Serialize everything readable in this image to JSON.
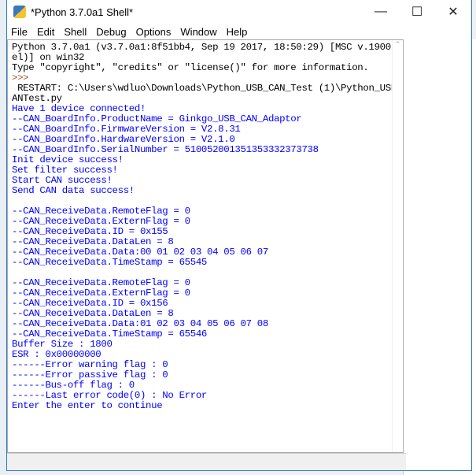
{
  "window": {
    "title": "*Python 3.7.0a1 Shell*"
  },
  "menu": [
    "File",
    "Edit",
    "Shell",
    "Debug",
    "Options",
    "Window",
    "Help"
  ],
  "lines": [
    {
      "t": "Python 3.7.0a1 (v3.7.0a1:8f51bb4, Sep 19 2017, 18:50:29) [MSC v.1900 32 bit (Int",
      "c": "k"
    },
    {
      "t": "el)] on win32",
      "c": "k"
    },
    {
      "t": "Type \"copyright\", \"credits\" or \"license()\" for more information.",
      "c": "k"
    },
    {
      "t": ">>>",
      "c": "p"
    },
    {
      "t": " RESTART: C:\\Users\\wdluo\\Downloads\\Python_USB_CAN_Test (1)\\Python_USB_CAN_Test\\C",
      "c": "k"
    },
    {
      "t": "ANTest.py",
      "c": "k"
    },
    {
      "t": "Have 1 device connected!",
      "c": "o"
    },
    {
      "t": "--CAN_BoardInfo.ProductName = Ginkgo_USB_CAN_Adaptor",
      "c": "o"
    },
    {
      "t": "--CAN_BoardInfo.FirmwareVersion = V2.8.31",
      "c": "o"
    },
    {
      "t": "--CAN_BoardInfo.HardwareVersion = V2.1.0",
      "c": "o"
    },
    {
      "t": "--CAN_BoardInfo.SerialNumber = 51005200135135333237373​8",
      "c": "o"
    },
    {
      "t": "Init device success!",
      "c": "o"
    },
    {
      "t": "Set filter success!",
      "c": "o"
    },
    {
      "t": "Start CAN success!",
      "c": "o"
    },
    {
      "t": "Send CAN data success!",
      "c": "o"
    },
    {
      "t": "",
      "c": "o"
    },
    {
      "t": "--CAN_ReceiveData.RemoteFlag = 0",
      "c": "o"
    },
    {
      "t": "--CAN_ReceiveData.ExternFlag = 0",
      "c": "o"
    },
    {
      "t": "--CAN_ReceiveData.ID = 0x155",
      "c": "o"
    },
    {
      "t": "--CAN_ReceiveData.DataLen = 8",
      "c": "o"
    },
    {
      "t": "--CAN_ReceiveData.Data:00 01 02 03 04 05 06 07",
      "c": "o"
    },
    {
      "t": "--CAN_ReceiveData.TimeStamp = 65545",
      "c": "o"
    },
    {
      "t": "",
      "c": "o"
    },
    {
      "t": "--CAN_ReceiveData.RemoteFlag = 0",
      "c": "o"
    },
    {
      "t": "--CAN_ReceiveData.ExternFlag = 0",
      "c": "o"
    },
    {
      "t": "--CAN_ReceiveData.ID = 0x156",
      "c": "o"
    },
    {
      "t": "--CAN_ReceiveData.DataLen = 8",
      "c": "o"
    },
    {
      "t": "--CAN_ReceiveData.Data:01 02 03 04 05 06 07 08",
      "c": "o"
    },
    {
      "t": "--CAN_ReceiveData.TimeStamp = 65546",
      "c": "o"
    },
    {
      "t": "Buffer Size : 1800",
      "c": "o"
    },
    {
      "t": "ESR : 0x00000000",
      "c": "o"
    },
    {
      "t": "------Error warning flag : 0",
      "c": "o"
    },
    {
      "t": "------Error passive flag : 0",
      "c": "o"
    },
    {
      "t": "------Bus-off flag : 0",
      "c": "o"
    },
    {
      "t": "------Last error code(0) : No Error",
      "c": "o"
    },
    {
      "t": "Enter the enter to continue",
      "c": "o"
    }
  ],
  "colors": {
    "stdout": "#0000ff",
    "prompt": "#a0522d",
    "border": "#2b79c2"
  }
}
